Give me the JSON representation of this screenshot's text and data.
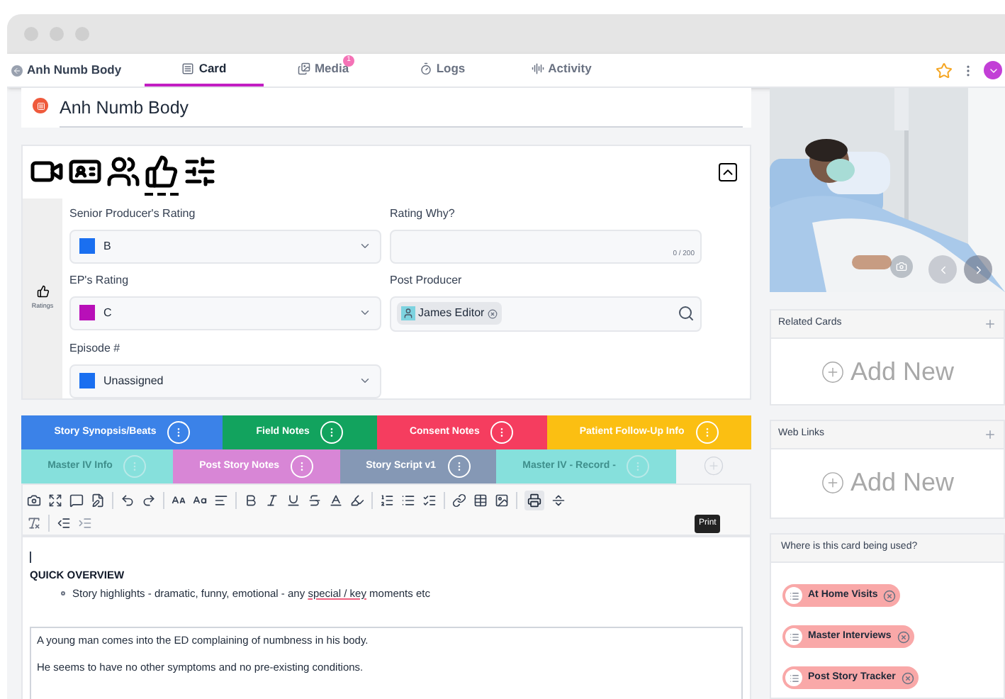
{
  "nav": {
    "back_title": "Anh Numb Body",
    "tabs": [
      {
        "label": "Card",
        "selected": true
      },
      {
        "label": "Media",
        "badge": "1",
        "selected": false
      },
      {
        "label": "Logs",
        "selected": false
      },
      {
        "label": "Activity",
        "selected": false
      }
    ]
  },
  "card_title": "Anh Numb Body",
  "sections": {
    "icons": [
      {
        "kind": "video",
        "selected": false
      },
      {
        "kind": "contact",
        "selected": false
      },
      {
        "kind": "movers",
        "selected": false
      },
      {
        "kind": "ratings",
        "selected": true
      },
      {
        "kind": "sliders",
        "selected": false
      }
    ],
    "side_label": "Ratings",
    "fields": [
      {
        "kind": "select",
        "label": "Senior Producer's Rating",
        "value": "B",
        "color": "#1a6ff0"
      },
      {
        "kind": "textarea",
        "label": "Rating Why?",
        "counter": "0 / 200"
      },
      {
        "kind": "select",
        "label": "EP's Rating",
        "value": "C",
        "color": "#b80fb8"
      },
      {
        "kind": "people",
        "label": "Post Producer",
        "person": "James Editor"
      },
      {
        "kind": "select",
        "label": "Episode #",
        "value": "Unassigned",
        "color": "#1a6ff0"
      }
    ]
  },
  "note_tabs": [
    [
      {
        "label": "Story Synopsis/Beats",
        "color": "#3b82e8",
        "faded": false
      },
      {
        "label": "Field Notes",
        "color": "#12a35e",
        "faded": false
      },
      {
        "label": "Consent Notes",
        "color": "#f53d5f",
        "faded": false
      },
      {
        "label": "Patient Follow-Up Info",
        "color": "#fbbf12",
        "faded": false
      }
    ],
    [
      {
        "label": "Master IV Info",
        "color": "#86e0dc",
        "faded": true
      },
      {
        "label": "Post Story Notes",
        "color": "#d886d6",
        "faded": false
      },
      {
        "label": "Story Script v1",
        "color": "#8598b5",
        "faded": false
      },
      {
        "label": "Master IV - Record -",
        "color": "#86e0dc",
        "faded": true
      }
    ]
  ],
  "toolbar": {
    "tooltip": "Print"
  },
  "editor": {
    "heading": "QUICK OVERVIEW",
    "bullet": [
      {
        "text": "Story highlights - dramatic, funny, emotional - any ",
        "flagged": false
      },
      {
        "text": "special / key",
        "flagged": true
      },
      {
        "text": " moments etc",
        "flagged": false
      }
    ],
    "quote": [
      "A young man comes into the ED complaining of numbness in his body.",
      "He seems to have no other symptoms and no pre-existing conditions."
    ]
  },
  "side": {
    "panels": [
      {
        "title": "Related Cards",
        "action": "Add New"
      },
      {
        "title": "Web Links",
        "action": "Add New"
      }
    ],
    "usage": {
      "title": "Where is this card being used?",
      "items": [
        {
          "label": "At Home Visits",
          "color": "#f9a8a8"
        },
        {
          "label": "Master Interviews",
          "color": "#f9a8a8"
        },
        {
          "label": "Post Story Tracker",
          "color": "#f9a8a8"
        }
      ]
    }
  }
}
